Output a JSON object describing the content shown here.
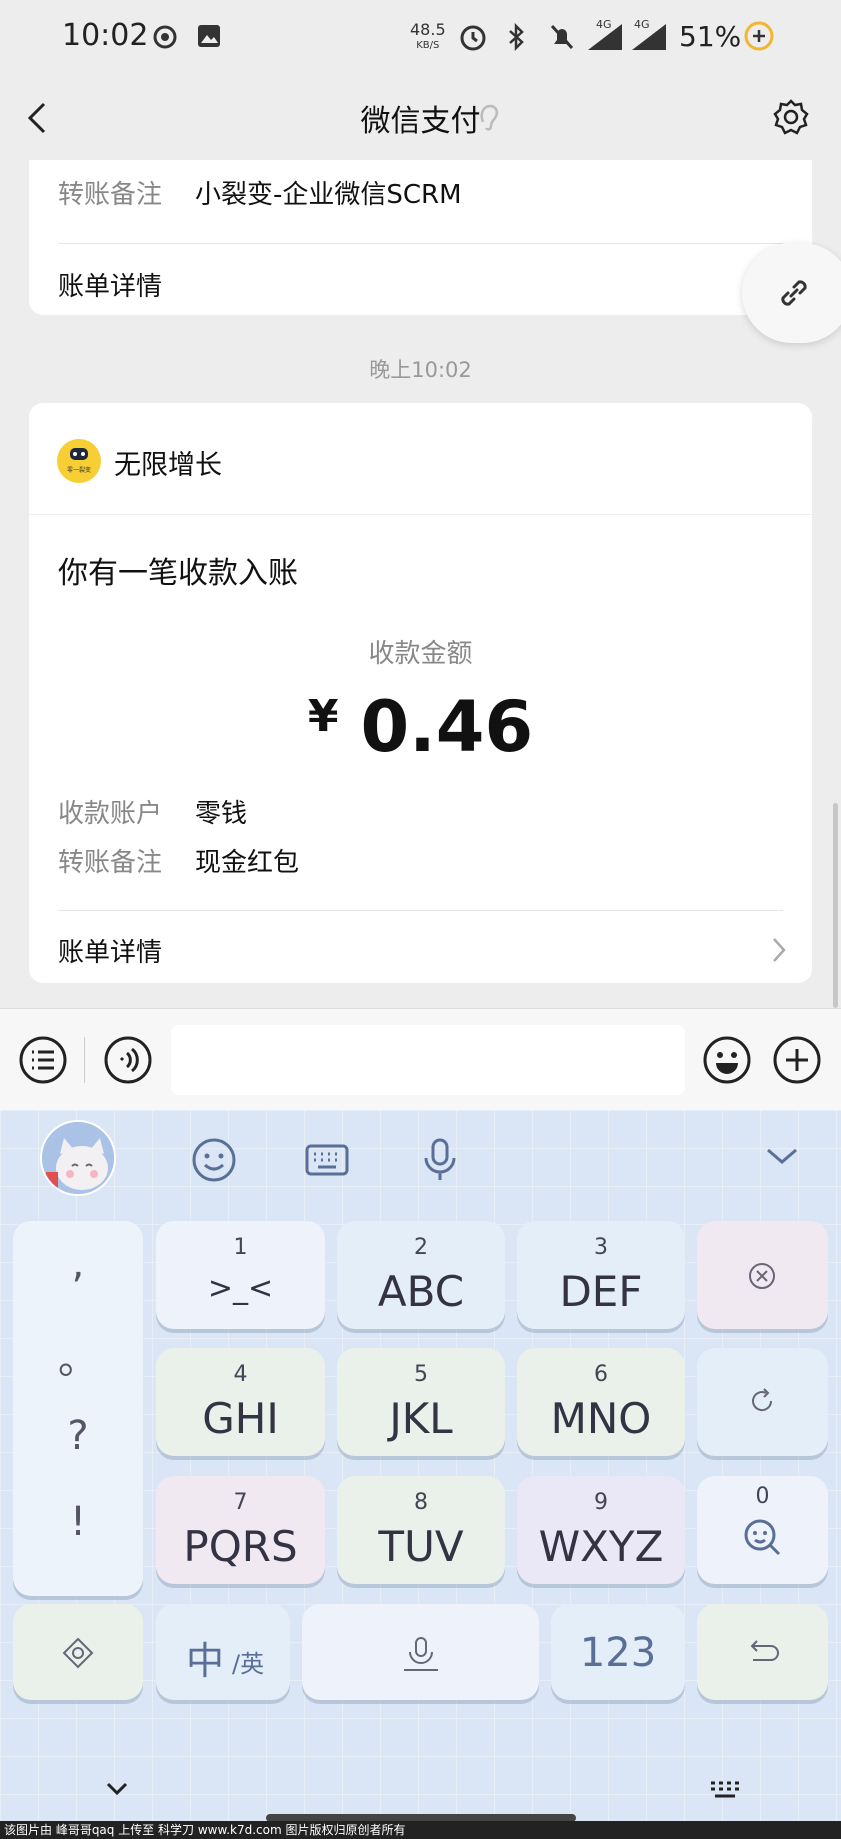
{
  "status_bar": {
    "time": "10:02",
    "net_speed": "48.5",
    "net_unit": "KB/S",
    "signal_1": "4G",
    "signal_2": "4G",
    "battery": "51%"
  },
  "nav": {
    "title": "微信支付"
  },
  "prev_card": {
    "remark_label": "转账备注",
    "remark_value": "小裂变-企业微信SCRM",
    "detail_label": "账单详情"
  },
  "timestamp": "晚上10:02",
  "payment_card": {
    "merchant_name": "无限增长",
    "avatar_text": "零一裂变",
    "heading": "你有一笔收款入账",
    "amount_label": "收款金额",
    "currency": "¥",
    "amount": "0.46",
    "account_label": "收款账户",
    "account_value": "零钱",
    "remark_label": "转账备注",
    "remark_value": "现金红包",
    "detail_label": "账单详情"
  },
  "keyboard": {
    "punct": [
      ",",
      "。",
      "?",
      "!"
    ],
    "keys": [
      {
        "num": "1",
        "main": ">_<"
      },
      {
        "num": "2",
        "main": "ABC"
      },
      {
        "num": "3",
        "main": "DEF"
      },
      {
        "num": "4",
        "main": "GHI"
      },
      {
        "num": "5",
        "main": "JKL"
      },
      {
        "num": "6",
        "main": "MNO"
      },
      {
        "num": "7",
        "main": "PQRS"
      },
      {
        "num": "8",
        "main": "TUV"
      },
      {
        "num": "9",
        "main": "WXYZ"
      }
    ],
    "search_num": "0",
    "lang_main": "中",
    "lang_alt": "/英",
    "num_key": "123"
  },
  "footer_text": "该图片由 峰哥哥qaq 上传至 科学刀 www.k7d.com 图片版权归原创者所有"
}
